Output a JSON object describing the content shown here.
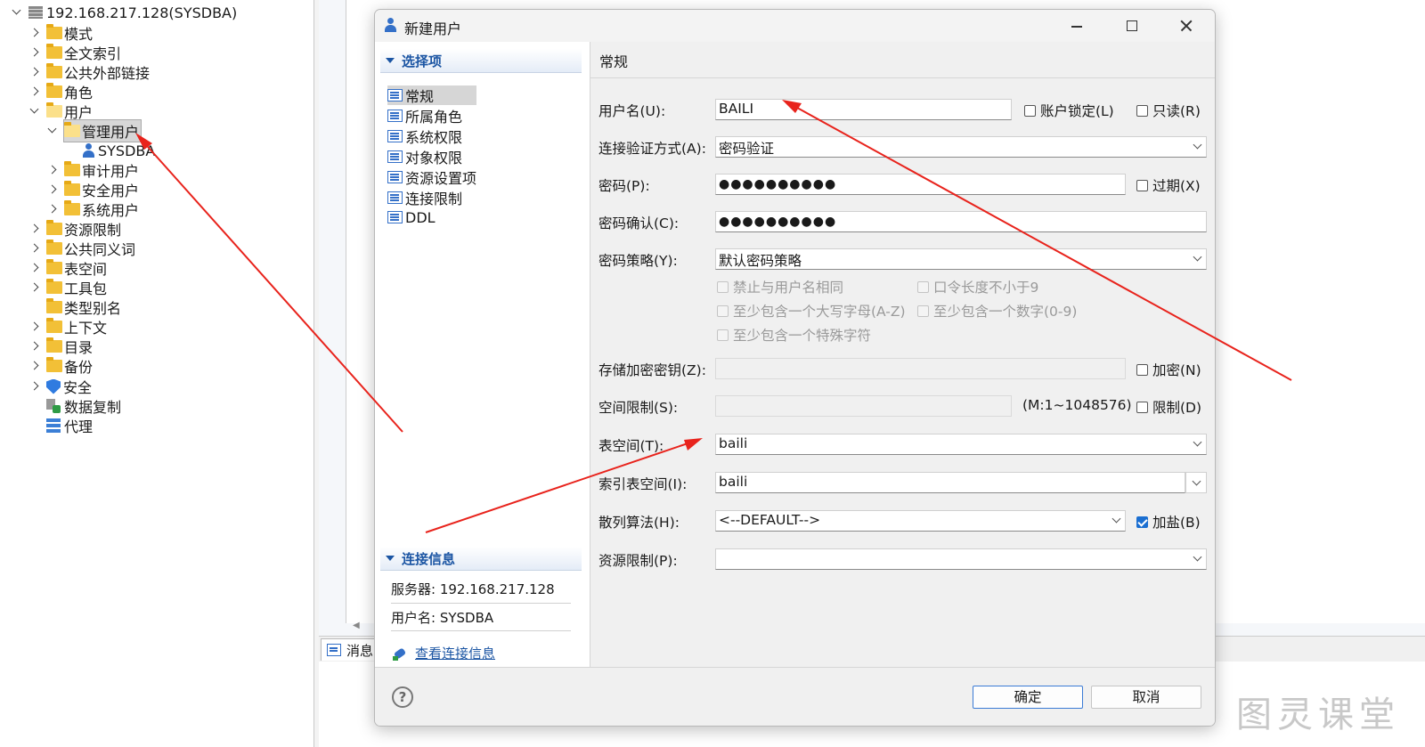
{
  "tree": {
    "root_label": "192.168.217.128(SYSDBA)",
    "items": [
      {
        "label": "模式"
      },
      {
        "label": "全文索引"
      },
      {
        "label": "公共外部链接"
      },
      {
        "label": "角色"
      },
      {
        "label": "用户"
      },
      {
        "label": "管理用户"
      },
      {
        "label": "SYSDBA"
      },
      {
        "label": "审计用户"
      },
      {
        "label": "安全用户"
      },
      {
        "label": "系统用户"
      },
      {
        "label": "资源限制"
      },
      {
        "label": "公共同义词"
      },
      {
        "label": "表空间"
      },
      {
        "label": "工具包"
      },
      {
        "label": "类型别名"
      },
      {
        "label": "上下文"
      },
      {
        "label": "目录"
      },
      {
        "label": "备份"
      },
      {
        "label": "安全"
      },
      {
        "label": "数据复制"
      },
      {
        "label": "代理"
      }
    ]
  },
  "background": {
    "messages_tab": "消息"
  },
  "dialog": {
    "title": "新建用户",
    "options_header": "选择项",
    "nav": [
      {
        "label": "常规"
      },
      {
        "label": "所属角色"
      },
      {
        "label": "系统权限"
      },
      {
        "label": "对象权限"
      },
      {
        "label": "资源设置项"
      },
      {
        "label": "连接限制"
      },
      {
        "label": "DDL"
      }
    ],
    "conn_header": "连接信息",
    "conn_server": "服务器: 192.168.217.128",
    "conn_user": "用户名: SYSDBA",
    "conn_link": "查看连接信息",
    "section_title": "常规",
    "form": {
      "username_label": "用户名(U):",
      "username_value": "BAILI",
      "lock_label": "账户锁定(L)",
      "readonly_label": "只读(R)",
      "auth_label": "连接验证方式(A):",
      "auth_value": "密码验证",
      "password_label": "密码(P):",
      "password_value": "●●●●●●●●●●",
      "expire_label": "过期(X)",
      "confirm_label": "密码确认(C):",
      "confirm_value": "●●●●●●●●●●",
      "policy_label": "密码策略(Y):",
      "policy_value": "默认密码策略",
      "policy_opt1": "禁止与用户名相同",
      "policy_opt2": "口令长度不小于9",
      "policy_opt3": "至少包含一个大写字母(A-Z)",
      "policy_opt4": "至少包含一个数字(0-9)",
      "policy_opt5": "至少包含一个特殊字符",
      "key_label": "存储加密密钥(Z):",
      "encrypt_label": "加密(N)",
      "space_label": "空间限制(S):",
      "space_range": "(M:1~1048576)",
      "limit_label": "限制(D)",
      "tablespace_label": "表空间(T):",
      "tablespace_value": "baili",
      "index_ts_label": "索引表空间(I):",
      "index_ts_value": "baili",
      "hash_label": "散列算法(H):",
      "hash_value": "<--DEFAULT-->",
      "salt_label": "加盐(B)",
      "resource_label": "资源限制(P):",
      "resource_value": ""
    },
    "ok_label": "确定",
    "cancel_label": "取消",
    "help_glyph": "?"
  },
  "watermark": "图灵课堂",
  "colors": {
    "accent": "#1b6fd1",
    "annotation_arrow": "#e8231c",
    "folder": "#f2c037"
  }
}
